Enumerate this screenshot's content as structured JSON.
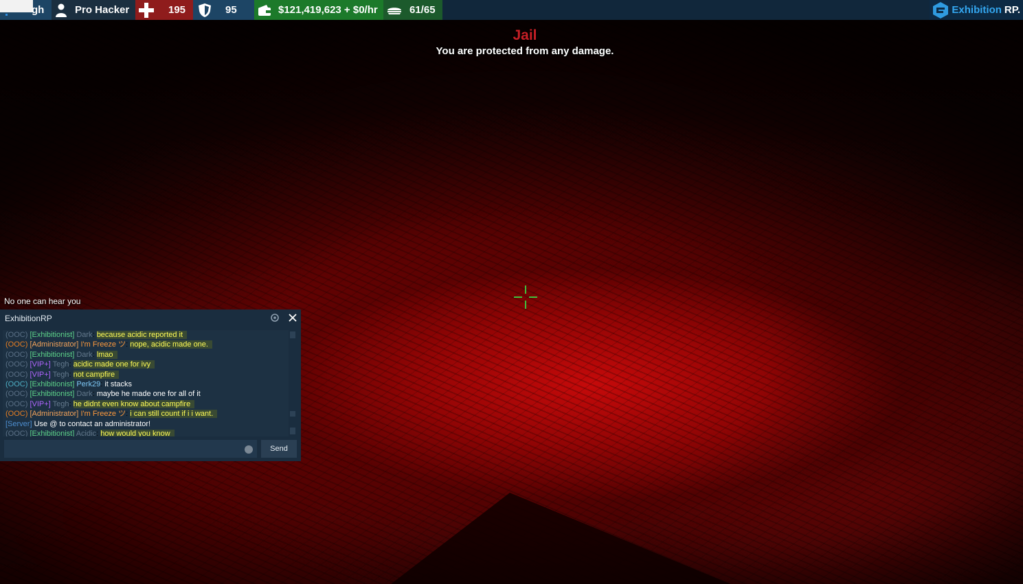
{
  "hud": {
    "name_fragment": "gh",
    "job": "Pro Hacker",
    "health": "195",
    "armor": "95",
    "money": "$121,419,623 + $0/hr",
    "hunger": "61/65",
    "brand_part1": "Exhibition",
    "brand_part2": "RP.",
    "colors": {
      "health_bg": "#8f1c1c",
      "armor_bg": "#1d4565",
      "money_bg": "#1c7a2a",
      "hunger_bg": "#1c5a2c",
      "bar_bg": "#11273b"
    },
    "icons": [
      "user-icon",
      "health-cross-icon",
      "shield-icon",
      "wallet-icon",
      "food-icon",
      "brand-logo-icon"
    ]
  },
  "notice": {
    "title": "Jail",
    "message": "You are protected from any damage."
  },
  "voice_status": "No one can hear you",
  "chat": {
    "title": "ExhibitionRP",
    "send_label": "Send",
    "input_value": "",
    "lines": [
      {
        "tag": "(OOC)",
        "rank": "[Exhibitionist]",
        "name": "Dark",
        "text": "because acidic reported it"
      },
      {
        "tag": "(OOC)",
        "rank": "[Administrator]",
        "name": "I'm Freeze ツ",
        "text": "nope, acidic made one."
      },
      {
        "tag": "(OOC)",
        "rank": "[Exhibitionist]",
        "name": "Dark",
        "text": "lmao"
      },
      {
        "tag": "(OOC)",
        "rank": "[VIP+]",
        "name": "Tegh",
        "text": "acidic made one for ivy"
      },
      {
        "tag": "(OOC)",
        "rank": "[VIP+]",
        "name": "Tegh",
        "text": "not campfire"
      },
      {
        "tag": "(OOC)",
        "rank": "[Exhibitionist]",
        "name": "Perk29",
        "text": "it stacks"
      },
      {
        "tag": "(OOC)",
        "rank": "[Exhibitionist]",
        "name": "Dark",
        "text": "maybe he made one for all of it"
      },
      {
        "tag": "(OOC)",
        "rank": "[VIP+]",
        "name": "Tegh",
        "text": "he didnt even know about campfire"
      },
      {
        "tag": "(OOC)",
        "rank": "[Administrator]",
        "name": "I'm Freeze ツ",
        "text": "i can still count if i i want."
      },
      {
        "tag": "[Server]",
        "rank": "",
        "name": "",
        "text": "Use @ to contact an administrator!"
      },
      {
        "tag": "(OOC)",
        "rank": "[Exhibitionist]",
        "name": "Acidic",
        "text": "how would you know"
      }
    ]
  }
}
